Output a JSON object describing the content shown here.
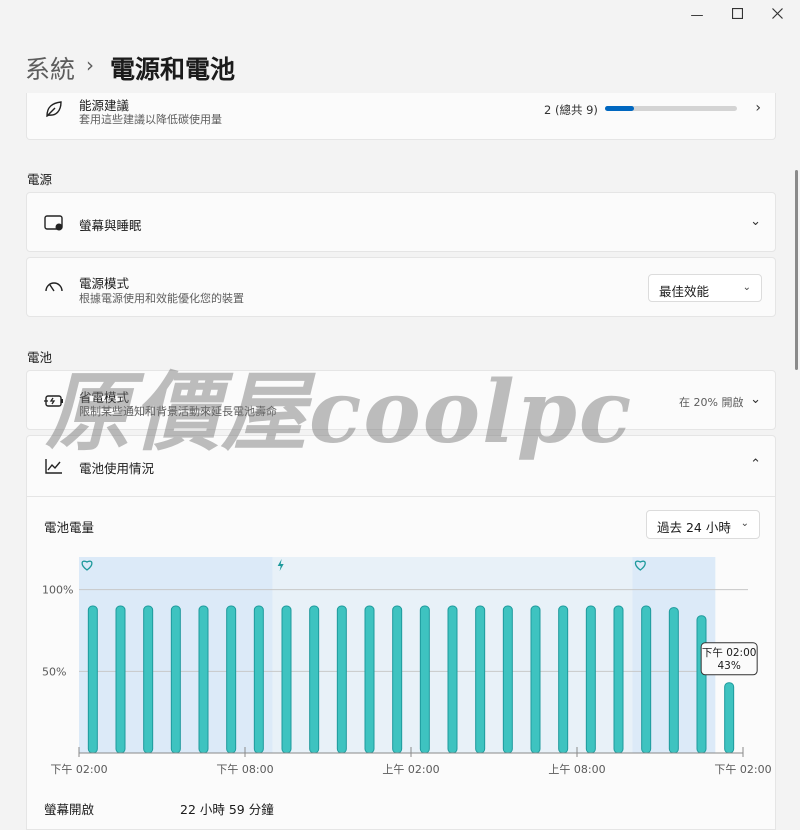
{
  "window": {
    "minimize_icon": "minimize-icon",
    "maximize_icon": "maximize-icon",
    "close_icon": "close-icon"
  },
  "breadcrumb": {
    "root": "系統",
    "separator": "›",
    "current": "電源和電池"
  },
  "energy_rec": {
    "title": "能源建議",
    "subtitle": "套用這些建議以降低碳使用量",
    "progress_text": "2 (總共 9)",
    "progress_fraction": 0.22222,
    "accent": "#0067c0"
  },
  "power_section": {
    "label": "電源"
  },
  "screen_sleep": {
    "title": "螢幕與睡眠"
  },
  "power_mode": {
    "title": "電源模式",
    "subtitle": "根據電源使用和效能優化您的裝置",
    "value": "最佳效能"
  },
  "battery_section": {
    "label": "電池"
  },
  "battery_saver": {
    "title": "省電模式",
    "subtitle": "限制某些通知和背景活動來延長電池壽命",
    "status": "在 20% 開啟"
  },
  "battery_usage": {
    "title": "電池使用情況",
    "level_label": "電池電量",
    "range_value": "過去 24 小時"
  },
  "chart_data": {
    "type": "bar",
    "title": "電池電量",
    "x_tick_labels": [
      "下午 02:00",
      "下午 08:00",
      "上午 02:00",
      "上午 08:00",
      "下午 02:00"
    ],
    "y_tick_labels": [
      "100%",
      "50%"
    ],
    "ylim": [
      0,
      120
    ],
    "values": [
      90,
      90,
      90,
      90,
      90,
      90,
      90,
      90,
      90,
      90,
      90,
      90,
      90,
      90,
      90,
      90,
      90,
      90,
      90,
      90,
      90,
      89,
      84,
      43
    ],
    "bar_color": "#3ec3c0",
    "bar_stroke": "#1e9a9c",
    "shaded_regions": [
      {
        "kind": "battery-saver",
        "from_bar": 0,
        "to_bar": 6,
        "color": "#dceaf8"
      },
      {
        "kind": "charging",
        "from_bar": 7,
        "to_bar": 19,
        "color": "#e8f1f8"
      },
      {
        "kind": "battery-saver",
        "from_bar": 20,
        "to_bar": 22,
        "color": "#dceaf8"
      }
    ],
    "region_icons": [
      "heart-leaf-icon",
      "lightning-icon",
      "heart-leaf-icon"
    ],
    "tooltip": {
      "time": "下午 02:00",
      "value": "43%"
    },
    "grid": true
  },
  "stats": {
    "screen_on_label": "螢幕開啟",
    "screen_on_value": "22 小時 59 分鐘"
  },
  "watermark": "原價屋 coolpc"
}
